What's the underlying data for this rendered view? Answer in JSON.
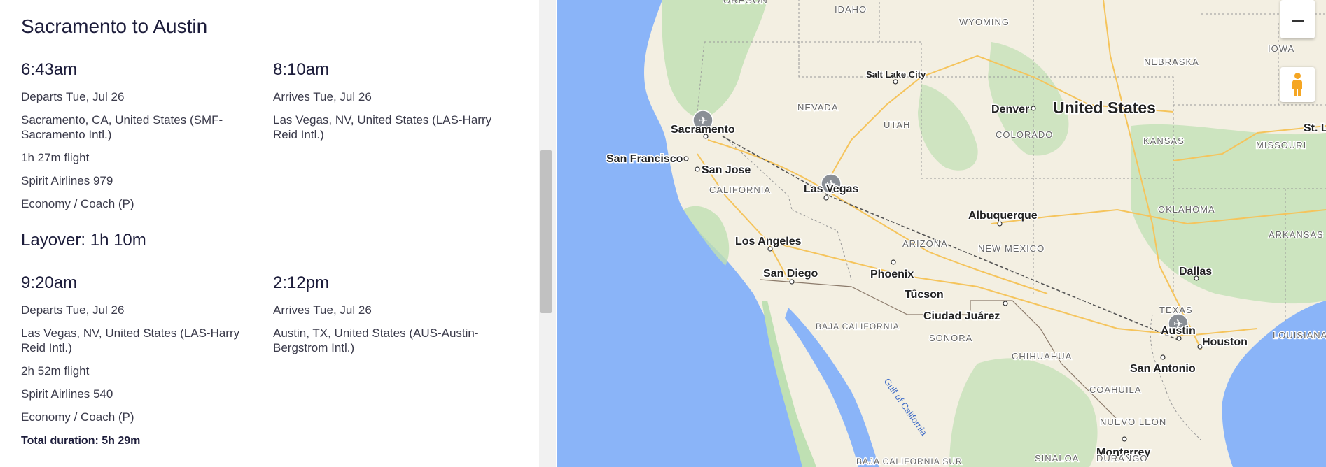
{
  "trip": {
    "title": "Sacramento to Austin",
    "segments": [
      {
        "depart": {
          "time": "6:43am",
          "date": "Departs Tue, Jul 26",
          "airport": "Sacramento, CA, United States (SMF-Sacramento Intl.)",
          "duration": "1h 27m flight",
          "airline": "Spirit Airlines 979",
          "cabin": "Economy / Coach (P)"
        },
        "arrive": {
          "time": "8:10am",
          "date": "Arrives Tue, Jul 26",
          "airport": "Las Vegas, NV, United States (LAS-Harry Reid Intl.)"
        }
      },
      {
        "depart": {
          "time": "9:20am",
          "date": "Departs Tue, Jul 26",
          "airport": "Las Vegas, NV, United States (LAS-Harry Reid Intl.)",
          "duration": "2h 52m flight",
          "airline": "Spirit Airlines 540",
          "cabin": "Economy / Coach (P)"
        },
        "arrive": {
          "time": "2:12pm",
          "date": "Arrives Tue, Jul 26",
          "airport": "Austin, TX, United States (AUS-Austin-Bergstrom Intl.)"
        }
      }
    ],
    "layover": "Layover: 1h 10m",
    "total": "Total duration: 5h 29m"
  },
  "map": {
    "country_label": "United States",
    "cities": [
      "Sacramento",
      "San Francisco",
      "San Jose",
      "Las Vegas",
      "Los Angeles",
      "San Diego",
      "Phoenix",
      "Tucson",
      "Ciudad Juárez",
      "Albuquerque",
      "Salt Lake City",
      "Denver",
      "Dallas",
      "Austin",
      "Houston",
      "San Antonio",
      "Monterrey",
      "St. L"
    ],
    "regions": [
      "OREGON",
      "IDAHO",
      "WYOMING",
      "NEBRASKA",
      "IOWA",
      "NEVADA",
      "UTAH",
      "COLORADO",
      "KANSAS",
      "MISSOURI",
      "CALIFORNIA",
      "OKLAHOMA",
      "ARKANSAS",
      "ARIZONA",
      "NEW MEXICO",
      "TEXAS",
      "LOUISIANA",
      "BAJA CALIFORNIA",
      "SONORA",
      "CHIHUAHUA",
      "COAHUILA",
      "NUEVO LEON",
      "BAJA CALIFORNIA SUR",
      "SINALOA",
      "DURANGO"
    ],
    "water": "Gulf of California",
    "zoom_out_icon": "minus-icon",
    "pegman_icon": "pegman-icon",
    "colors": {
      "water": "#8ab4f8",
      "land": "#f3efe2",
      "green": "#bfe0b3",
      "route": "#555555",
      "highway": "#f5c45c"
    }
  }
}
